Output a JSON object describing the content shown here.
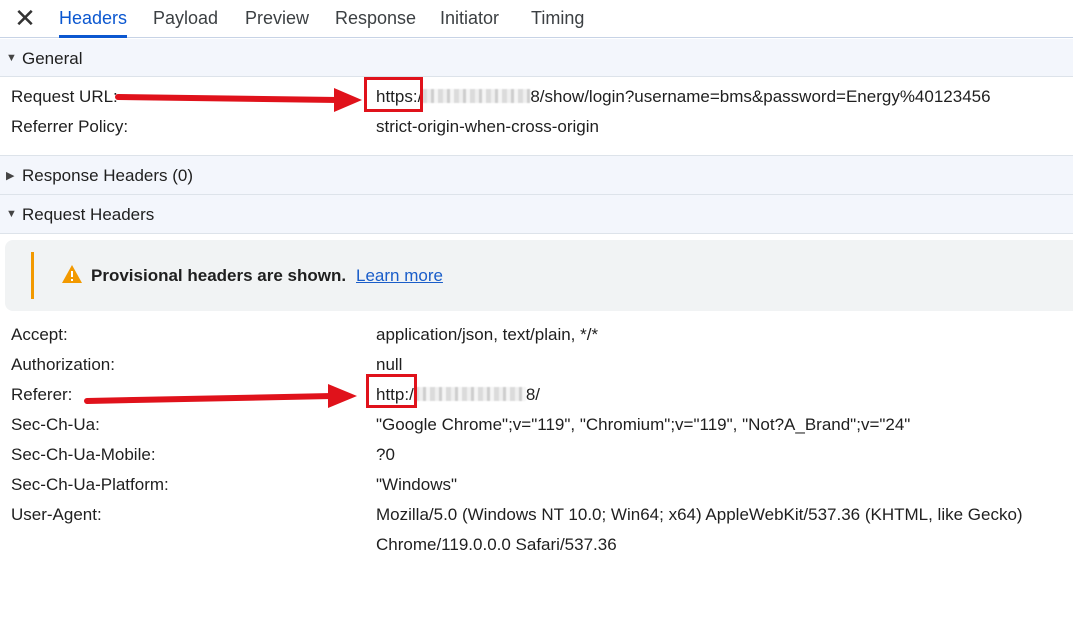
{
  "tabs": [
    {
      "label": "Headers",
      "active": true
    },
    {
      "label": "Payload",
      "active": false
    },
    {
      "label": "Preview",
      "active": false
    },
    {
      "label": "Response",
      "active": false
    },
    {
      "label": "Initiator",
      "active": false
    },
    {
      "label": "Timing",
      "active": false
    }
  ],
  "close_icon": "close-icon",
  "general": {
    "title": "General",
    "expanded": true,
    "rows": [
      {
        "name": "Request URL:",
        "scheme": "https:",
        "after_scheme": "/",
        "value_rest": "8/show/login?username=bms&password=Energy%40123456"
      },
      {
        "name": "Referrer Policy:",
        "value": "strict-origin-when-cross-origin"
      }
    ]
  },
  "response_headers": {
    "title": "Response Headers (0)",
    "expanded": false
  },
  "request_headers": {
    "title": "Request Headers",
    "expanded": true,
    "warning": {
      "text": "Provisional headers are shown.",
      "link": "Learn more",
      "icon": "warning-triangle-icon"
    },
    "rows": [
      {
        "name": "Accept:",
        "value": "application/json, text/plain, */*"
      },
      {
        "name": "Authorization:",
        "value": "null"
      },
      {
        "name": "Referer:",
        "scheme": "http:",
        "after_scheme": "/",
        "value_rest": "8/"
      },
      {
        "name": "Sec-Ch-Ua:",
        "value": "\"Google Chrome\";v=\"119\", \"Chromium\";v=\"119\", \"Not?A_Brand\";v=\"24\""
      },
      {
        "name": "Sec-Ch-Ua-Mobile:",
        "value": "?0"
      },
      {
        "name": "Sec-Ch-Ua-Platform:",
        "value": "\"Windows\""
      },
      {
        "name": "User-Agent:",
        "value": "Mozilla/5.0 (Windows NT 10.0; Win64; x64) AppleWebKit/537.36 (KHTML, like Gecko)",
        "value_line2": "Chrome/119.0.0.0 Safari/537.36"
      }
    ]
  },
  "colors": {
    "accent": "#0b57d0",
    "annotation_red": "#e0121b",
    "warning": "#f29900",
    "link": "#1a5dc9"
  }
}
